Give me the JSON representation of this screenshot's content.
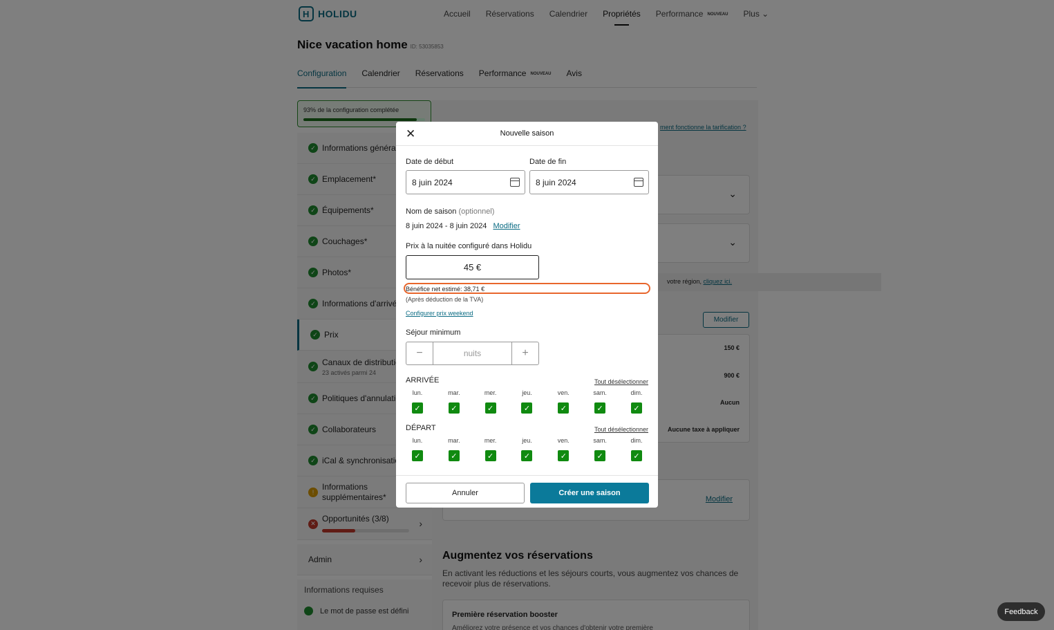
{
  "brand": {
    "name": "HOLIDU"
  },
  "nav": {
    "items": [
      {
        "label": "Accueil"
      },
      {
        "label": "Réservations"
      },
      {
        "label": "Calendrier"
      },
      {
        "label": "Propriétés"
      },
      {
        "label": "Performance"
      },
      {
        "label": "Plus ⌄"
      }
    ],
    "new_badge": "NOUVEAU"
  },
  "property": {
    "title": "Nice vacation home",
    "id": "ID: 53035853"
  },
  "tabs": [
    {
      "label": "Configuration"
    },
    {
      "label": "Calendrier"
    },
    {
      "label": "Réservations"
    },
    {
      "label": "Performance"
    },
    {
      "label": "Avis"
    }
  ],
  "progress": {
    "label": "93% de la configuration complétée",
    "value": 0.93
  },
  "sidebar": {
    "items": [
      {
        "label": "Informations générales"
      },
      {
        "label": "Emplacement*"
      },
      {
        "label": "Équipements*"
      },
      {
        "label": "Couchages*"
      },
      {
        "label": "Photos*"
      },
      {
        "label": "Informations d'arrivée"
      },
      {
        "label": "Prix"
      },
      {
        "label": "Canaux de distribution",
        "sub": "23 activés parmi 24"
      },
      {
        "label": "Politiques d'annulation"
      },
      {
        "label": "Collaborateurs"
      },
      {
        "label": "iCal & synchronisation"
      },
      {
        "label": "Informations supplémentaires*"
      },
      {
        "label": "Opportunités (3/8)"
      },
      {
        "label": "Admin"
      }
    ],
    "required_title": "Informations requises",
    "required_item": "Le mot de passe est défini"
  },
  "background": {
    "pricing_link": "ment fonctionne la tarification ?",
    "region_text": "votre région,",
    "region_link": "cliquez ici.",
    "modify": "Modifier",
    "prices": [
      "150 €",
      "900 €",
      "Aucun",
      "Aucune taxe à appliquer"
    ],
    "modify_link": "Modifier",
    "boost_title": "Augmentez vos réservations",
    "boost_text": "En activant les réductions et les séjours courts, vous augmentez vos chances de recevoir plus de réservations.",
    "booster_title": "Première réservation booster",
    "booster_text": "Améliorez votre présence et vos chances d'obtenir votre première"
  },
  "feedback": "Feedback",
  "modal": {
    "title": "Nouvelle saison",
    "start_label": "Date de début",
    "start_value": "8 juin 2024",
    "end_label": "Date de fin",
    "end_value": "8 juin 2024",
    "name_label": "Nom de saison",
    "name_optional": "(optionnel)",
    "name_value": "8 juin 2024 - 8 juin 2024",
    "name_modify": "Modifier",
    "price_label": "Prix à la nuitée configuré dans Holidu",
    "price_value": "45 €",
    "net_profit": "Bénéfice net estimé: 38,71 €",
    "tva_note": "(Après déduction de la TVA)",
    "weekend_link": "Configurer prix weekend",
    "min_stay_label": "Séjour minimum",
    "min_stay_placeholder": "nuits",
    "arrival_title": "ARRIVÉE",
    "departure_title": "DÉPART",
    "deselect_all": "Tout désélectionner",
    "days": [
      "lun.",
      "mar.",
      "mer.",
      "jeu.",
      "ven.",
      "sam.",
      "dim."
    ],
    "cancel": "Annuler",
    "create": "Créer une saison"
  }
}
